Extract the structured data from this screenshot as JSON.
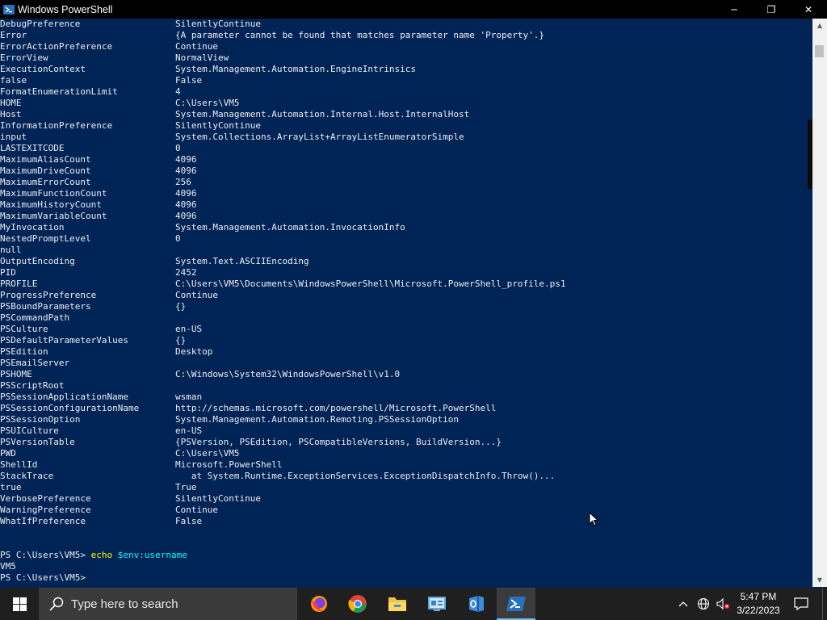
{
  "window": {
    "title": "Windows PowerShell",
    "minimize": "─",
    "maximize": "❐",
    "close": "✕"
  },
  "variables": [
    {
      "name": "DebugPreference",
      "value": "SilentlyContinue"
    },
    {
      "name": "Error",
      "value": "{A parameter cannot be found that matches parameter name 'Property'.}"
    },
    {
      "name": "ErrorActionPreference",
      "value": "Continue"
    },
    {
      "name": "ErrorView",
      "value": "NormalView"
    },
    {
      "name": "ExecutionContext",
      "value": "System.Management.Automation.EngineIntrinsics"
    },
    {
      "name": "false",
      "value": "False"
    },
    {
      "name": "FormatEnumerationLimit",
      "value": "4"
    },
    {
      "name": "HOME",
      "value": "C:\\Users\\VM5"
    },
    {
      "name": "Host",
      "value": "System.Management.Automation.Internal.Host.InternalHost"
    },
    {
      "name": "InformationPreference",
      "value": "SilentlyContinue"
    },
    {
      "name": "input",
      "value": "System.Collections.ArrayList+ArrayListEnumeratorSimple"
    },
    {
      "name": "LASTEXITCODE",
      "value": "0"
    },
    {
      "name": "MaximumAliasCount",
      "value": "4096"
    },
    {
      "name": "MaximumDriveCount",
      "value": "4096"
    },
    {
      "name": "MaximumErrorCount",
      "value": "256"
    },
    {
      "name": "MaximumFunctionCount",
      "value": "4096"
    },
    {
      "name": "MaximumHistoryCount",
      "value": "4096"
    },
    {
      "name": "MaximumVariableCount",
      "value": "4096"
    },
    {
      "name": "MyInvocation",
      "value": "System.Management.Automation.InvocationInfo"
    },
    {
      "name": "NestedPromptLevel",
      "value": "0"
    },
    {
      "name": "null",
      "value": ""
    },
    {
      "name": "OutputEncoding",
      "value": "System.Text.ASCIIEncoding"
    },
    {
      "name": "PID",
      "value": "2452"
    },
    {
      "name": "PROFILE",
      "value": "C:\\Users\\VM5\\Documents\\WindowsPowerShell\\Microsoft.PowerShell_profile.ps1"
    },
    {
      "name": "ProgressPreference",
      "value": "Continue"
    },
    {
      "name": "PSBoundParameters",
      "value": "{}"
    },
    {
      "name": "PSCommandPath",
      "value": ""
    },
    {
      "name": "PSCulture",
      "value": "en-US"
    },
    {
      "name": "PSDefaultParameterValues",
      "value": "{}"
    },
    {
      "name": "PSEdition",
      "value": "Desktop"
    },
    {
      "name": "PSEmailServer",
      "value": ""
    },
    {
      "name": "PSHOME",
      "value": "C:\\Windows\\System32\\WindowsPowerShell\\v1.0"
    },
    {
      "name": "PSScriptRoot",
      "value": ""
    },
    {
      "name": "PSSessionApplicationName",
      "value": "wsman"
    },
    {
      "name": "PSSessionConfigurationName",
      "value": "http://schemas.microsoft.com/powershell/Microsoft.PowerShell"
    },
    {
      "name": "PSSessionOption",
      "value": "System.Management.Automation.Remoting.PSSessionOption"
    },
    {
      "name": "PSUICulture",
      "value": "en-US"
    },
    {
      "name": "PSVersionTable",
      "value": "{PSVersion, PSEdition, PSCompatibleVersions, BuildVersion...}"
    },
    {
      "name": "PWD",
      "value": "C:\\Users\\VM5"
    },
    {
      "name": "ShellId",
      "value": "Microsoft.PowerShell"
    },
    {
      "name": "StackTrace",
      "value": "   at System.Runtime.ExceptionServices.ExceptionDispatchInfo.Throw()..."
    },
    {
      "name": "true",
      "value": "True"
    },
    {
      "name": "VerbosePreference",
      "value": "SilentlyContinue"
    },
    {
      "name": "WarningPreference",
      "value": "Continue"
    },
    {
      "name": "WhatIfPreference",
      "value": "False"
    }
  ],
  "session": {
    "prompt1": "PS C:\\Users\\VM5> ",
    "command": "echo",
    "argument": " $env:username",
    "output": "VM5",
    "prompt2": "PS C:\\Users\\VM5> "
  },
  "taskbar": {
    "search_placeholder": "Type here to search",
    "apps": [
      "firefox-icon",
      "chrome-icon",
      "file-explorer-icon",
      "control-panel-icon",
      "azure-data-studio-icon",
      "powershell-icon"
    ],
    "time": "5:47 PM",
    "date": "3/22/2023"
  },
  "colors": {
    "console_bg": "#012456",
    "console_fg": "#eeedf0",
    "command": "#ffff00",
    "argument": "#00ffff"
  }
}
